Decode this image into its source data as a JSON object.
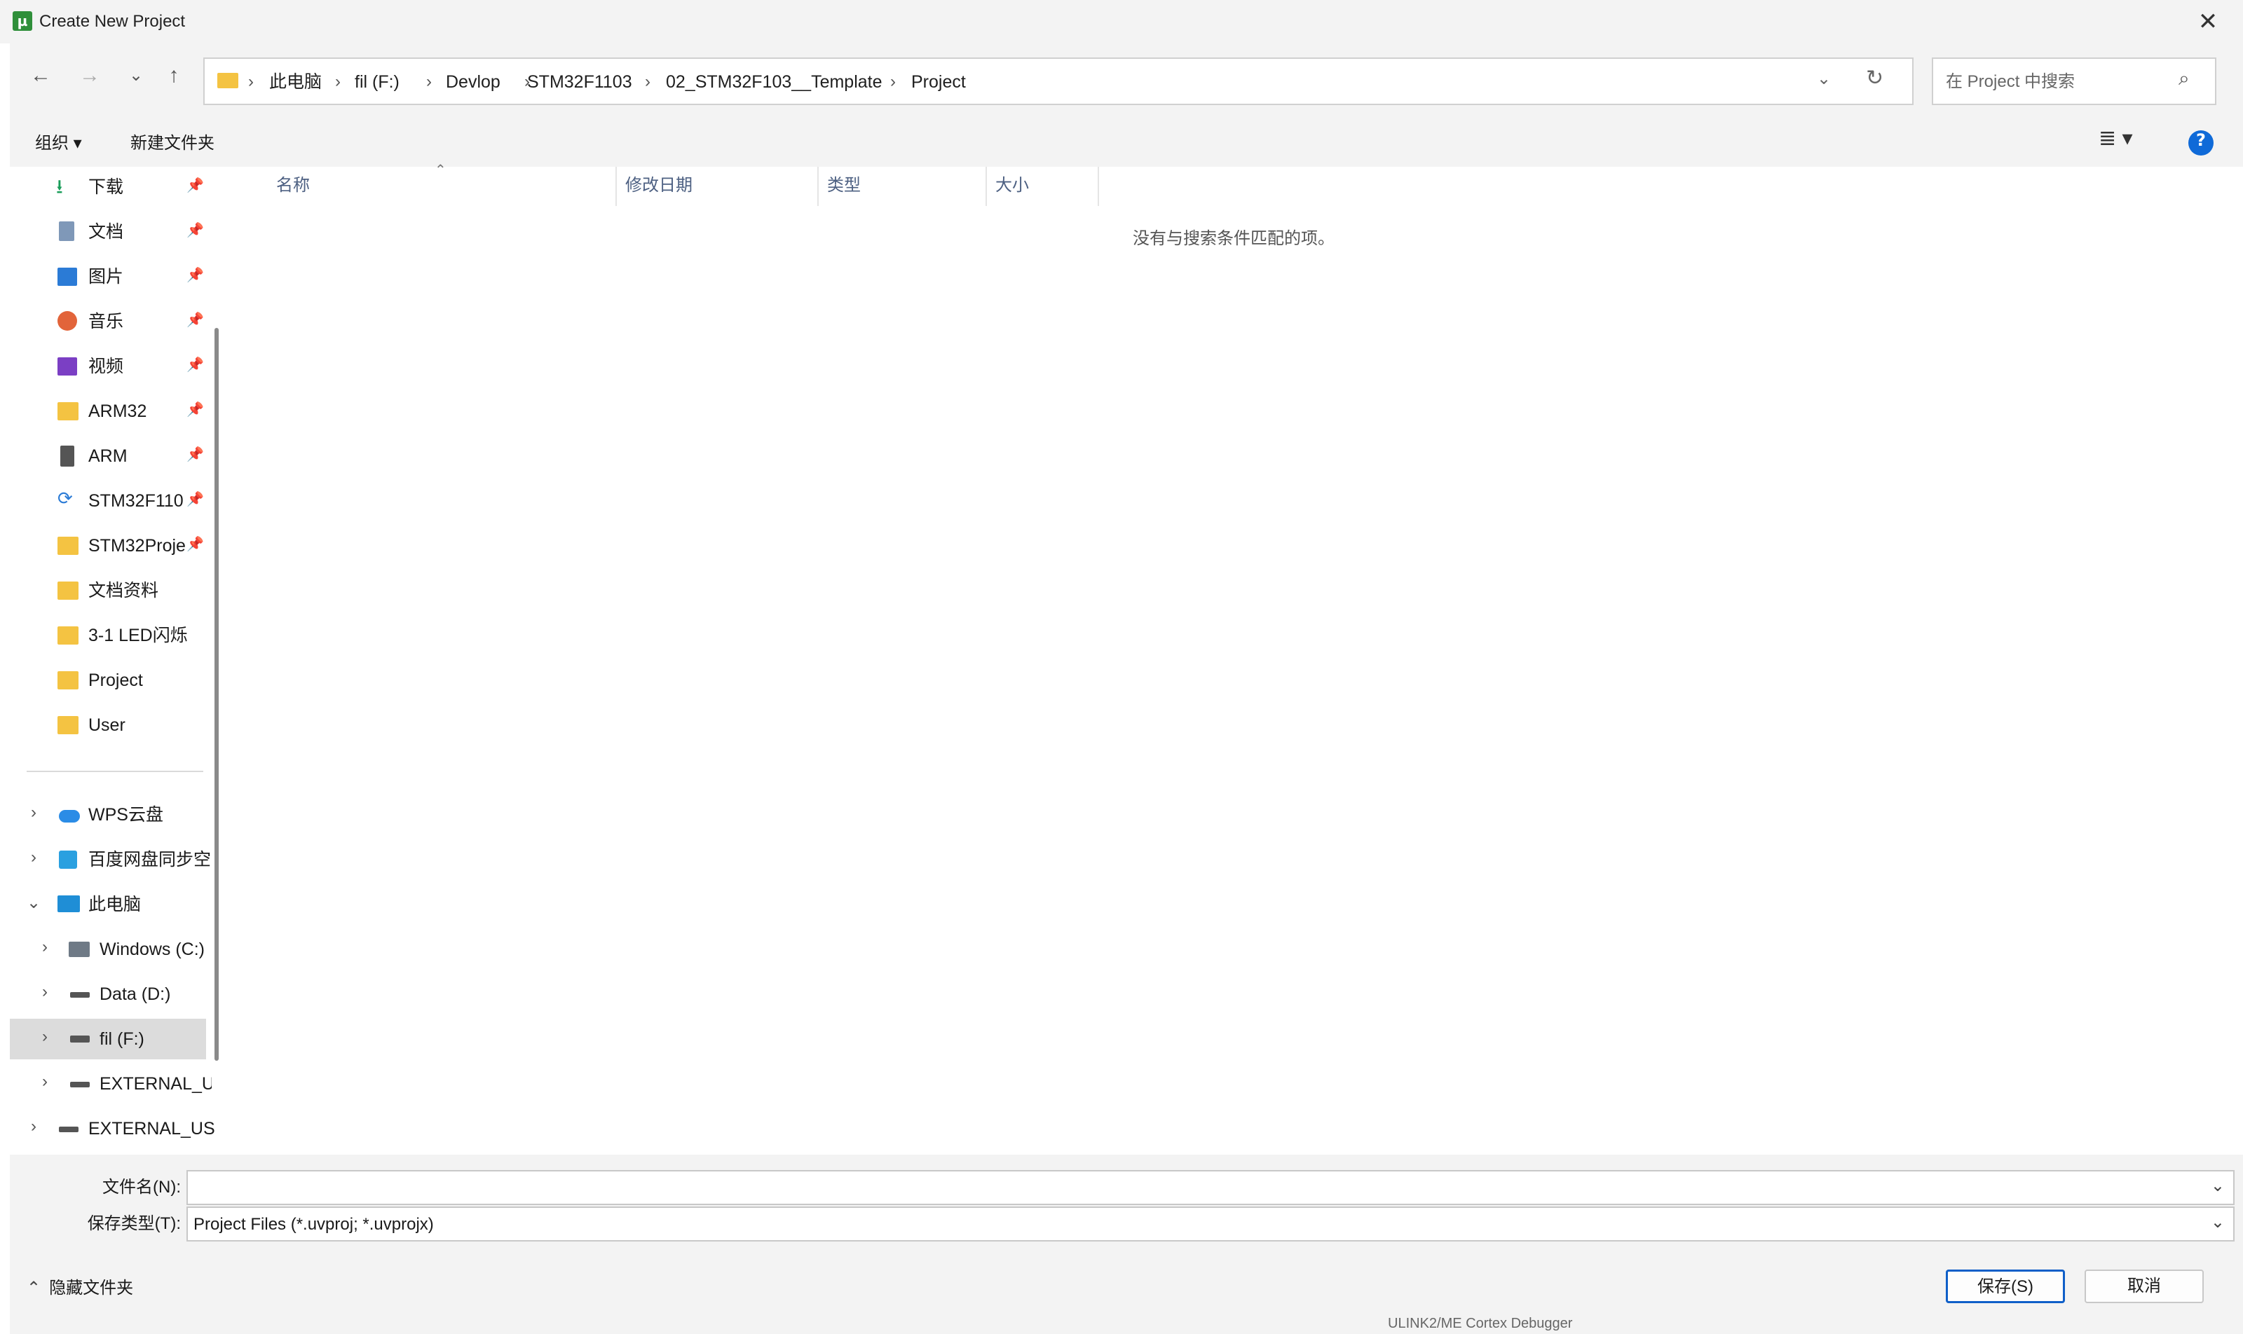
{
  "window": {
    "title": "Create New Project",
    "close_glyph": "✕"
  },
  "nav": {
    "back": "←",
    "forward": "→",
    "recent": "⌄",
    "up": "↑",
    "breadcrumbs": [
      "此电脑",
      "fil (F:)",
      "Devlop",
      "STM32F1103",
      "02_STM32F103__Template",
      "Project"
    ],
    "dropdown": "⌄",
    "refresh": "↻"
  },
  "search": {
    "placeholder": "在 Project 中搜索",
    "icon": "⌕"
  },
  "toolbar": {
    "organize": "组织 ▾",
    "new_folder": "新建文件夹",
    "view": "≣ ▾",
    "help": "?"
  },
  "sidebar": {
    "pinned": [
      {
        "label": "下载",
        "icon": "download-icon"
      },
      {
        "label": "文档",
        "icon": "documents-icon"
      },
      {
        "label": "图片",
        "icon": "pictures-icon"
      },
      {
        "label": "音乐",
        "icon": "music-icon"
      },
      {
        "label": "视频",
        "icon": "videos-icon"
      },
      {
        "label": "ARM32",
        "icon": "folder-icon"
      },
      {
        "label": "ARM",
        "icon": "folder-icon"
      },
      {
        "label": "STM32F110",
        "icon": "sync-icon"
      },
      {
        "label": "STM32Proje",
        "icon": "folder-icon"
      }
    ],
    "recent": [
      {
        "label": "文档资料"
      },
      {
        "label": "3-1 LED闪烁"
      },
      {
        "label": "Project"
      },
      {
        "label": "User"
      }
    ],
    "tree": [
      {
        "label": "WPS云盘"
      },
      {
        "label": "百度网盘同步空"
      },
      {
        "label": "此电脑"
      },
      {
        "label": "Windows (C:)"
      },
      {
        "label": "Data (D:)"
      },
      {
        "label": "fil (F:)"
      },
      {
        "label": "EXTERNAL_U"
      },
      {
        "label": "EXTERNAL_USI"
      }
    ],
    "pin_glyph": "📌"
  },
  "columns": [
    "名称",
    "修改日期",
    "类型",
    "大小"
  ],
  "empty_message": "没有与搜索条件匹配的项。",
  "bottom": {
    "filename_label": "文件名(N):",
    "filename_value": "",
    "filetype_label": "保存类型(T):",
    "filetype_value": "Project Files (*.uvproj; *.uvprojx)",
    "hide_folders": "隐藏文件夹",
    "save": "保存(S)",
    "cancel": "取消"
  },
  "status_strip": "ULINK2/ME Cortex Debugger"
}
